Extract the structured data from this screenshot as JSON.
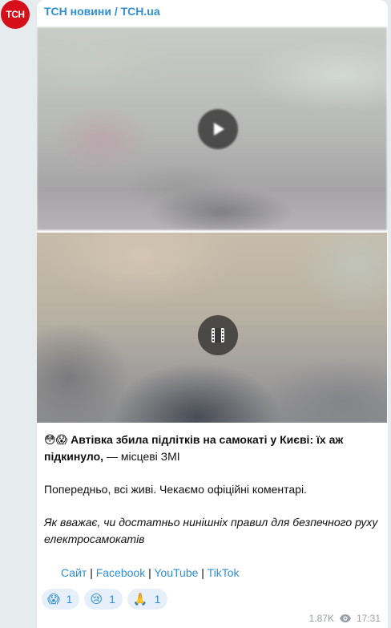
{
  "channel": {
    "avatar_text": "ТСН",
    "name": "ТСН новини / TCH.ua"
  },
  "media": [
    {
      "type": "video",
      "icon": "play-icon"
    },
    {
      "type": "video",
      "icon": "film-icon"
    }
  ],
  "post": {
    "emoji_prefix": "😳😱",
    "headline_bold": "Автівка збила підлітків на самокаті у Києві: їх аж підкинуло,",
    "headline_rest": " — місцеві ЗМІ",
    "paragraph": "Попередньо, всі живі. Чекаємо офіційні коментарі.",
    "question": "Як вважає, чи достатньо нинішніх правил для безпечного руху електросамокатів"
  },
  "links": {
    "site": "Сайт",
    "facebook": "Facebook",
    "youtube": "YouTube",
    "tiktok": "TikTok",
    "separator": "|"
  },
  "reactions": [
    {
      "emoji": "😱",
      "count": "1"
    },
    {
      "emoji": "😢",
      "count": "1"
    },
    {
      "emoji": "🙏",
      "count": "1"
    }
  ],
  "meta": {
    "views": "1.87K",
    "time": "17:31"
  },
  "colors": {
    "accent": "#2f8fd4",
    "avatar_bg": "#d6101b",
    "reaction_bg": "#e7f0fa"
  }
}
